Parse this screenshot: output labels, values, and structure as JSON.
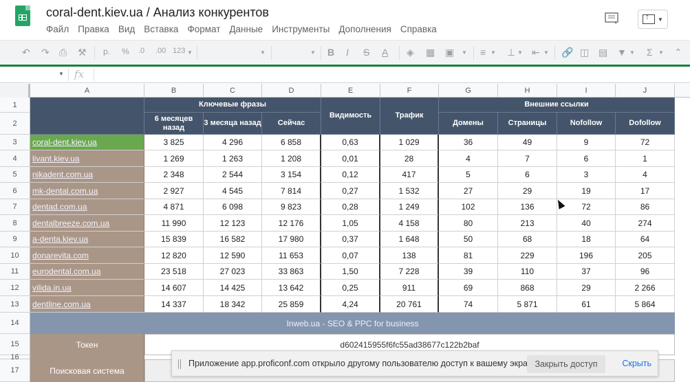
{
  "app": {
    "title": "coral-dent.kiev.ua / Анализ конкурентов",
    "menu": [
      "Файл",
      "Правка",
      "Вид",
      "Вставка",
      "Формат",
      "Данные",
      "Инструменты",
      "Дополнения",
      "Справка"
    ]
  },
  "toolbar": {
    "currency": "р.",
    "percent": "%",
    "decimal_less": ".0",
    "decimal_more": ".00",
    "more_formats": "123"
  },
  "formula_bar": {
    "fx": "fx"
  },
  "columns": [
    "A",
    "B",
    "C",
    "D",
    "E",
    "F",
    "G",
    "H",
    "I",
    "J"
  ],
  "rows": [
    "1",
    "2",
    "3",
    "4",
    "5",
    "6",
    "7",
    "8",
    "9",
    "10",
    "11",
    "12",
    "13",
    "14",
    "15",
    "16",
    "17"
  ],
  "header": {
    "keyphrases": "Ключевые фразы",
    "six_months": "6 месяцев назад",
    "three_months": "3 месяца назад",
    "now": "Сейчас",
    "visibility": "Видимость",
    "traffic": "Трафик",
    "backlinks": "Внешние ссылки",
    "domains": "Домены",
    "pages": "Страницы",
    "nofollow": "Nofollow",
    "dofollow": "Dofollow"
  },
  "table": [
    {
      "site": "coral-dent.kiev.ua",
      "b": "3 825",
      "c": "4 296",
      "d": "6 858",
      "e": "0,63",
      "f": "1 029",
      "g": "36",
      "h": "49",
      "i": "9",
      "j": "72"
    },
    {
      "site": "livant.kiev.ua",
      "b": "1 269",
      "c": "1 263",
      "d": "1 208",
      "e": "0,01",
      "f": "28",
      "g": "4",
      "h": "7",
      "i": "6",
      "j": "1"
    },
    {
      "site": "nikadent.com.ua",
      "b": "2 348",
      "c": "2 544",
      "d": "3 154",
      "e": "0,12",
      "f": "417",
      "g": "5",
      "h": "6",
      "i": "3",
      "j": "4"
    },
    {
      "site": "mk-dental.com.ua",
      "b": "2 927",
      "c": "4 545",
      "d": "7 814",
      "e": "0,27",
      "f": "1 532",
      "g": "27",
      "h": "29",
      "i": "19",
      "j": "17"
    },
    {
      "site": "dentad.com.ua",
      "b": "4 871",
      "c": "6 098",
      "d": "9 823",
      "e": "0,28",
      "f": "1 249",
      "g": "102",
      "h": "136",
      "i": "72",
      "j": "86"
    },
    {
      "site": "dentalbreeze.com.ua",
      "b": "11 990",
      "c": "12 123",
      "d": "12 176",
      "e": "1,05",
      "f": "4 158",
      "g": "80",
      "h": "213",
      "i": "40",
      "j": "274"
    },
    {
      "site": "a-denta.kiev.ua",
      "b": "15 839",
      "c": "16 582",
      "d": "17 980",
      "e": "0,37",
      "f": "1 648",
      "g": "50",
      "h": "68",
      "i": "18",
      "j": "64"
    },
    {
      "site": "donarevita.com",
      "b": "12 820",
      "c": "12 590",
      "d": "11 653",
      "e": "0,07",
      "f": "138",
      "g": "81",
      "h": "229",
      "i": "196",
      "j": "205"
    },
    {
      "site": "eurodental.com.ua",
      "b": "23 518",
      "c": "27 023",
      "d": "33 863",
      "e": "1,50",
      "f": "7 228",
      "g": "39",
      "h": "110",
      "i": "37",
      "j": "96"
    },
    {
      "site": "vilida.in.ua",
      "b": "14 607",
      "c": "14 425",
      "d": "13 642",
      "e": "0,25",
      "f": "911",
      "g": "69",
      "h": "868",
      "i": "29",
      "j": "2 266"
    },
    {
      "site": "dentline.com.ua",
      "b": "14 337",
      "c": "18 342",
      "d": "25 859",
      "e": "4,24",
      "f": "20 761",
      "g": "74",
      "h": "5 871",
      "i": "61",
      "j": "5 864"
    }
  ],
  "footer": {
    "banner": "Inweb.ua - SEO & PPC for business",
    "token_label": "Токен",
    "token_value": "d602415955f6fc55ad38677c122b2baf",
    "search_label": "Поисковая система"
  },
  "notification": {
    "message": "Приложение app.proficonf.com открыло другому пользователю доступ к вашему экрану",
    "stop": "Закрыть доступ",
    "hide": "Скрыть"
  }
}
